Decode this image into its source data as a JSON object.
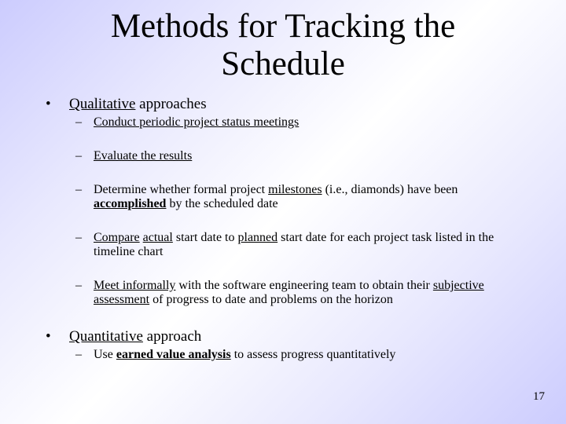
{
  "slide": {
    "title_line1": "Methods for Tracking the",
    "title_line2": "Schedule",
    "page_number": "17",
    "bullet_glyph": "•",
    "dash_glyph": "–"
  },
  "qualitative": {
    "heading_underlined": "Qualitative",
    "heading_rest": " approaches",
    "items": [
      {
        "parts": [
          "Conduct periodic project status meetings"
        ]
      },
      {
        "parts": [
          "Evaluate the results"
        ]
      },
      {
        "parts": [
          "Determine whether formal project ",
          "milestones",
          " (i.e., diamonds) have been ",
          "accomplished",
          " by the scheduled date"
        ]
      },
      {
        "parts": [
          "Compare",
          " ",
          "actual",
          " start date to ",
          "planned",
          " start date for each project task listed in the timeline chart"
        ]
      },
      {
        "parts": [
          "Meet informally",
          " with the software engineering team to obtain their ",
          "subjective assessment",
          " of progress to date and problems on the horizon"
        ]
      }
    ]
  },
  "quantitative": {
    "heading_underlined": "Quantitative",
    "heading_rest": " approach",
    "items": [
      {
        "parts": [
          "Use ",
          "earned value analysis",
          " to assess progress quantitatively"
        ]
      }
    ]
  }
}
